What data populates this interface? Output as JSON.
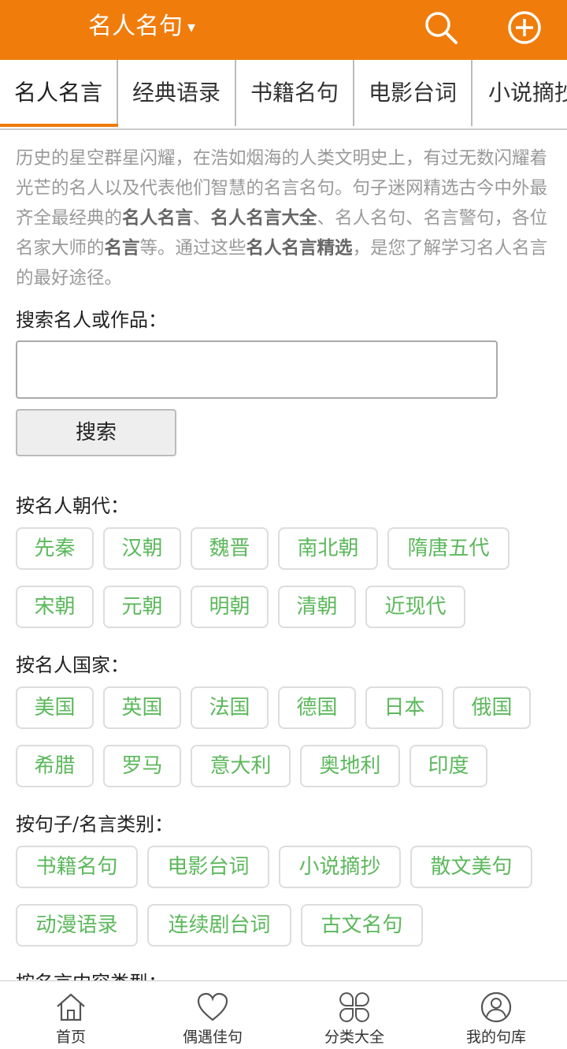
{
  "header": {
    "title": "名人名句",
    "dropdown_arrow": "▾",
    "icons": [
      "search-icon",
      "plus-circle-icon"
    ],
    "accent_color": "#f07c0c"
  },
  "tabs": [
    {
      "label": "名人名言",
      "active": true
    },
    {
      "label": "经典语录",
      "active": false
    },
    {
      "label": "书籍名句",
      "active": false
    },
    {
      "label": "电影台词",
      "active": false
    },
    {
      "label": "小说摘抄",
      "active": false
    }
  ],
  "intro": {
    "p1": "历史的星空群星闪耀，在浩如烟海的人类文明史上，有过无数闪耀着光芒的名人以及代表他们智慧的名言名句。句子迷网精选古今中外最齐全最经典的",
    "b1": "名人名言",
    "p2": "、",
    "b2": "名人名言大全",
    "p3": "、名人名句、名言警句，各位名家大师的",
    "b3": "名言",
    "p4": "等。通过这些",
    "b4": "名人名言精选",
    "p5": "，是您了解学习名人名言的最好途径。"
  },
  "search": {
    "label": "搜索名人或作品：",
    "value": "",
    "button_label": "搜索"
  },
  "dynasty": {
    "label": "按名人朝代：",
    "rows": [
      [
        "先秦",
        "汉朝",
        "魏晋",
        "南北朝",
        "隋唐五代"
      ],
      [
        "宋朝",
        "元朝",
        "明朝",
        "清朝",
        "近现代"
      ]
    ]
  },
  "country": {
    "label": "按名人国家：",
    "rows": [
      [
        "美国",
        "英国",
        "法国",
        "德国",
        "日本",
        "俄国"
      ],
      [
        "希腊",
        "罗马",
        "意大利",
        "奥地利",
        "印度"
      ]
    ]
  },
  "category": {
    "label": "按句子/名言类别：",
    "rows": [
      [
        "书籍名句",
        "电影台词",
        "小说摘抄",
        "散文美句"
      ],
      [
        "动漫语录",
        "连续剧台词",
        "古文名句"
      ]
    ]
  },
  "content_type": {
    "label": "按名言内容类型："
  },
  "bottom_nav": [
    {
      "label": "首页",
      "icon": "home-icon"
    },
    {
      "label": "偶遇佳句",
      "icon": "heart-icon"
    },
    {
      "label": "分类大全",
      "icon": "clover-icon"
    },
    {
      "label": "我的句库",
      "icon": "user-icon"
    }
  ],
  "tag_color": "#5cb85c"
}
